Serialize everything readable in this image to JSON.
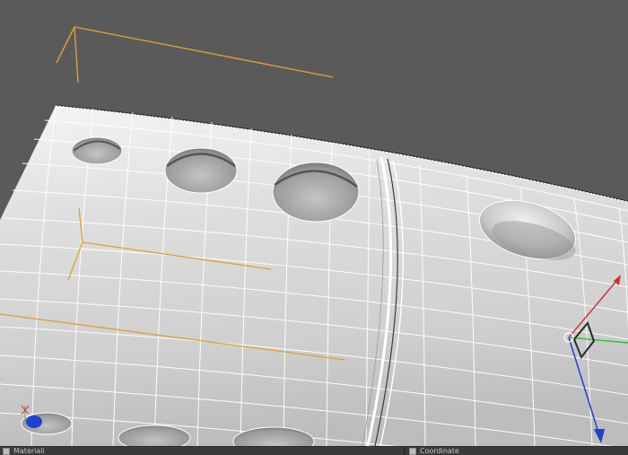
{
  "viewport": {
    "background_color": "#5a5a5a",
    "object_color": "#d8d8d8",
    "wire_color": "#ffffff",
    "guide_color": "#e0a030",
    "axis_x_color": "#d03030",
    "axis_y_color": "#30c030",
    "axis_z_color": "#2040d0"
  },
  "bottom_bar": {
    "left_panel_label": "Materiali",
    "right_panel_label": "Coordinate"
  }
}
